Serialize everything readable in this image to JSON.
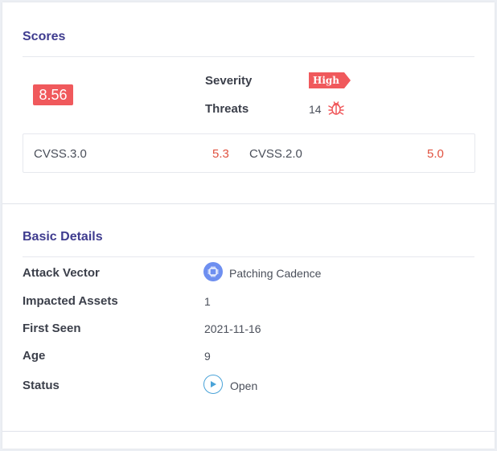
{
  "scores": {
    "title": "Scores",
    "overall": "8.56",
    "severity_label": "Severity",
    "severity_value": "High",
    "threats_label": "Threats",
    "threats_value": "14",
    "cvss": [
      {
        "label": "CVSS.3.0",
        "value": "5.3"
      },
      {
        "label": "CVSS.2.0",
        "value": "5.0"
      }
    ]
  },
  "basic_details": {
    "title": "Basic Details",
    "rows": [
      {
        "label": "Attack Vector",
        "value": "Patching Cadence",
        "icon": "chip-icon"
      },
      {
        "label": "Impacted Assets",
        "value": "1"
      },
      {
        "label": "First Seen",
        "value": "2021-11-16"
      },
      {
        "label": "Age",
        "value": "9"
      },
      {
        "label": "Status",
        "value": "Open",
        "icon": "play-circle-icon"
      }
    ]
  },
  "colors": {
    "accent_title": "#3f3c8f",
    "severity_red": "#f0595c",
    "cvss_value": "#e0513f",
    "attack_icon_bg": "#6e8ff0",
    "status_icon": "#4aa3d8"
  }
}
